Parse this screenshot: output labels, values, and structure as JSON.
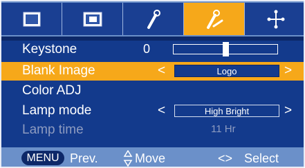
{
  "tabs": [
    {
      "icon": "screen-icon"
    },
    {
      "icon": "picture-in-picture-icon"
    },
    {
      "icon": "wrench-icon"
    },
    {
      "icon": "tools-icon",
      "active": true
    },
    {
      "icon": "network-icon"
    }
  ],
  "menu": {
    "keystone": {
      "label": "Keystone",
      "value": "0",
      "level": 0.5
    },
    "blank_image": {
      "label": "Blank Image",
      "value": "Logo",
      "left_arrow": "<",
      "right_arrow": ">"
    },
    "color_adj": {
      "label": "Color ADJ"
    },
    "lamp_mode": {
      "label": "Lamp mode",
      "value": "High Bright",
      "left_arrow": "<",
      "right_arrow": ">"
    },
    "lamp_time": {
      "label": "Lamp time",
      "value": "11 Hr"
    }
  },
  "footer": {
    "menu_key": "MENU",
    "prev": "Prev.",
    "move_icon": "up-down-arrows-icon",
    "move": "Move",
    "select_icon": "left-right-arrows-icon",
    "select_symbol": "<>",
    "select": "Select"
  },
  "colors": {
    "background": "#133a8c",
    "highlight": "#f6a81a",
    "tab_bar": "#6b90c9",
    "text": "#ffffff",
    "disabled_text": "#8d9bc0"
  }
}
